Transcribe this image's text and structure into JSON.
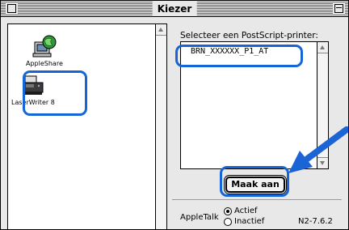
{
  "window": {
    "title": "Kiezer"
  },
  "left_list": {
    "items": [
      {
        "label": "AppleShare",
        "icon": "appleshare-icon"
      },
      {
        "label": "LaserWriter 8",
        "icon": "laserwriter-icon"
      }
    ]
  },
  "right": {
    "prompt": "Selecteer een PostScript-printer:",
    "printers": [
      "BRN_XXXXXX_P1_AT"
    ],
    "create_button": "Maak aan"
  },
  "appletalk": {
    "label": "AppleTalk",
    "options": [
      {
        "label": "Actief",
        "selected": true
      },
      {
        "label": "Inactief",
        "selected": false
      }
    ]
  },
  "version": "N2-7.6.2",
  "colors": {
    "highlight": "#1565d8",
    "arrow": "#1a64d6"
  }
}
